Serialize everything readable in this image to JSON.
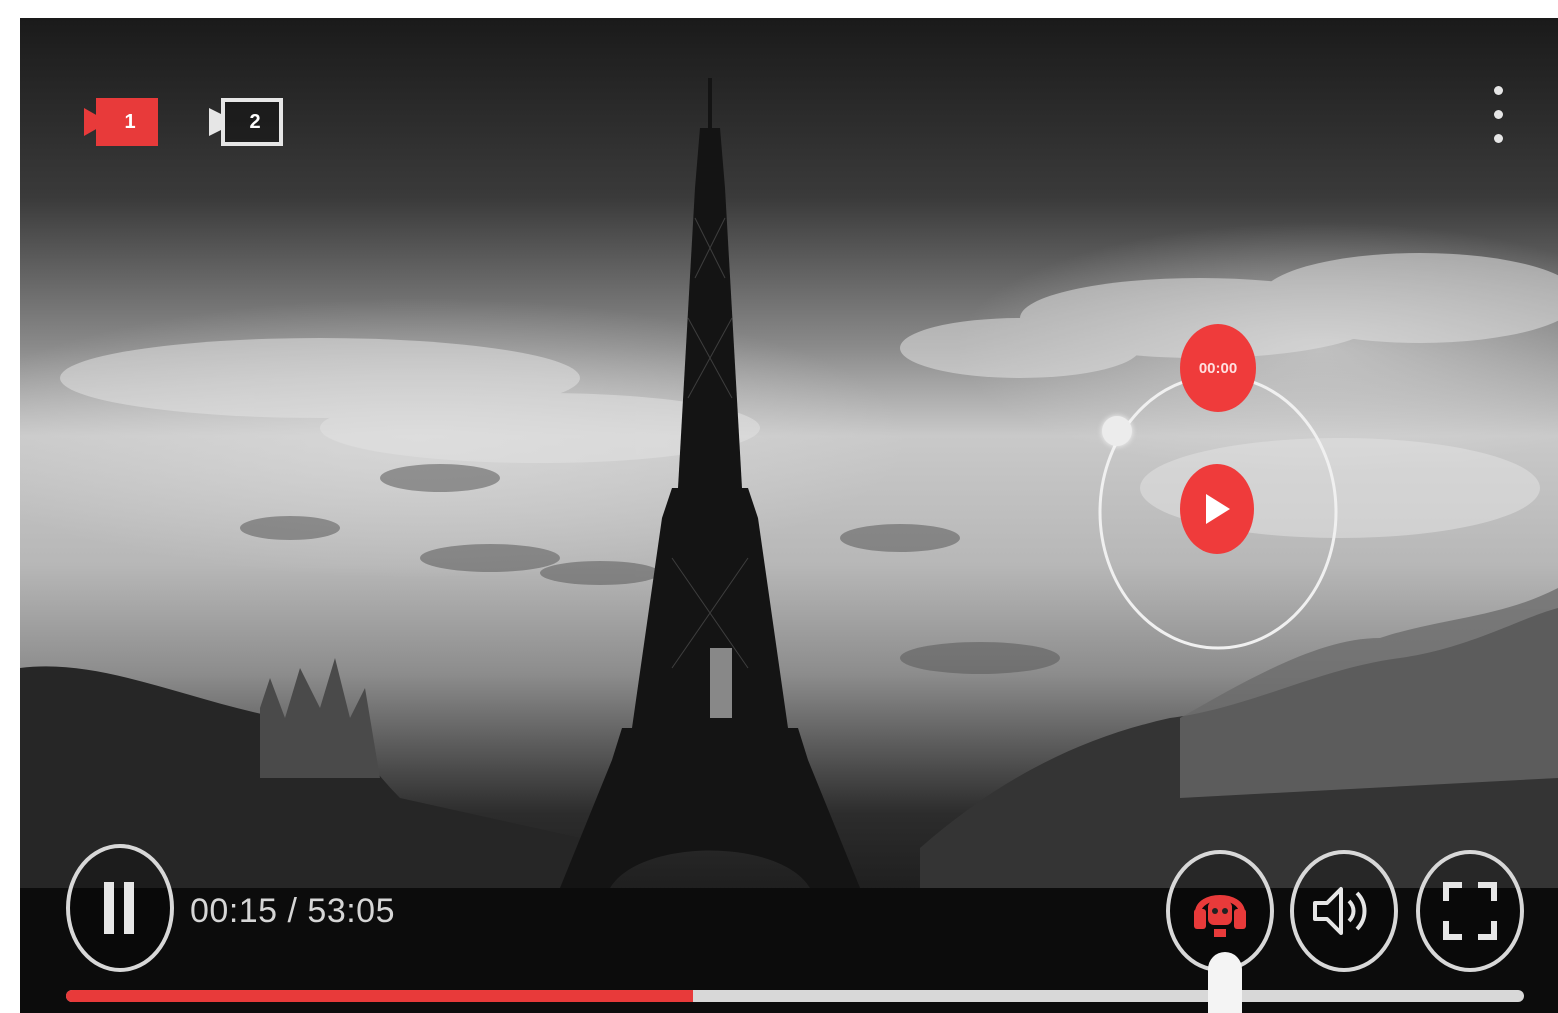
{
  "cameras": [
    {
      "label": "1",
      "active": true,
      "color": "#e83a3a"
    },
    {
      "label": "2",
      "active": false,
      "color": "#ffffff"
    }
  ],
  "menu": {
    "icon": "more-vertical-icon"
  },
  "dial": {
    "time_label": "00:00",
    "play_icon": "play-icon",
    "accent": "#ef3b3b"
  },
  "controls": {
    "pause_icon": "pause-icon",
    "time_display": "00:15 / 53:05",
    "headset_icon": "headset-icon",
    "volume_icon": "volume-icon",
    "fullscreen_icon": "fullscreen-icon"
  },
  "progress": {
    "value": 0.43,
    "fill_color": "#e83a3a",
    "track_color": "#d8d8d8"
  }
}
